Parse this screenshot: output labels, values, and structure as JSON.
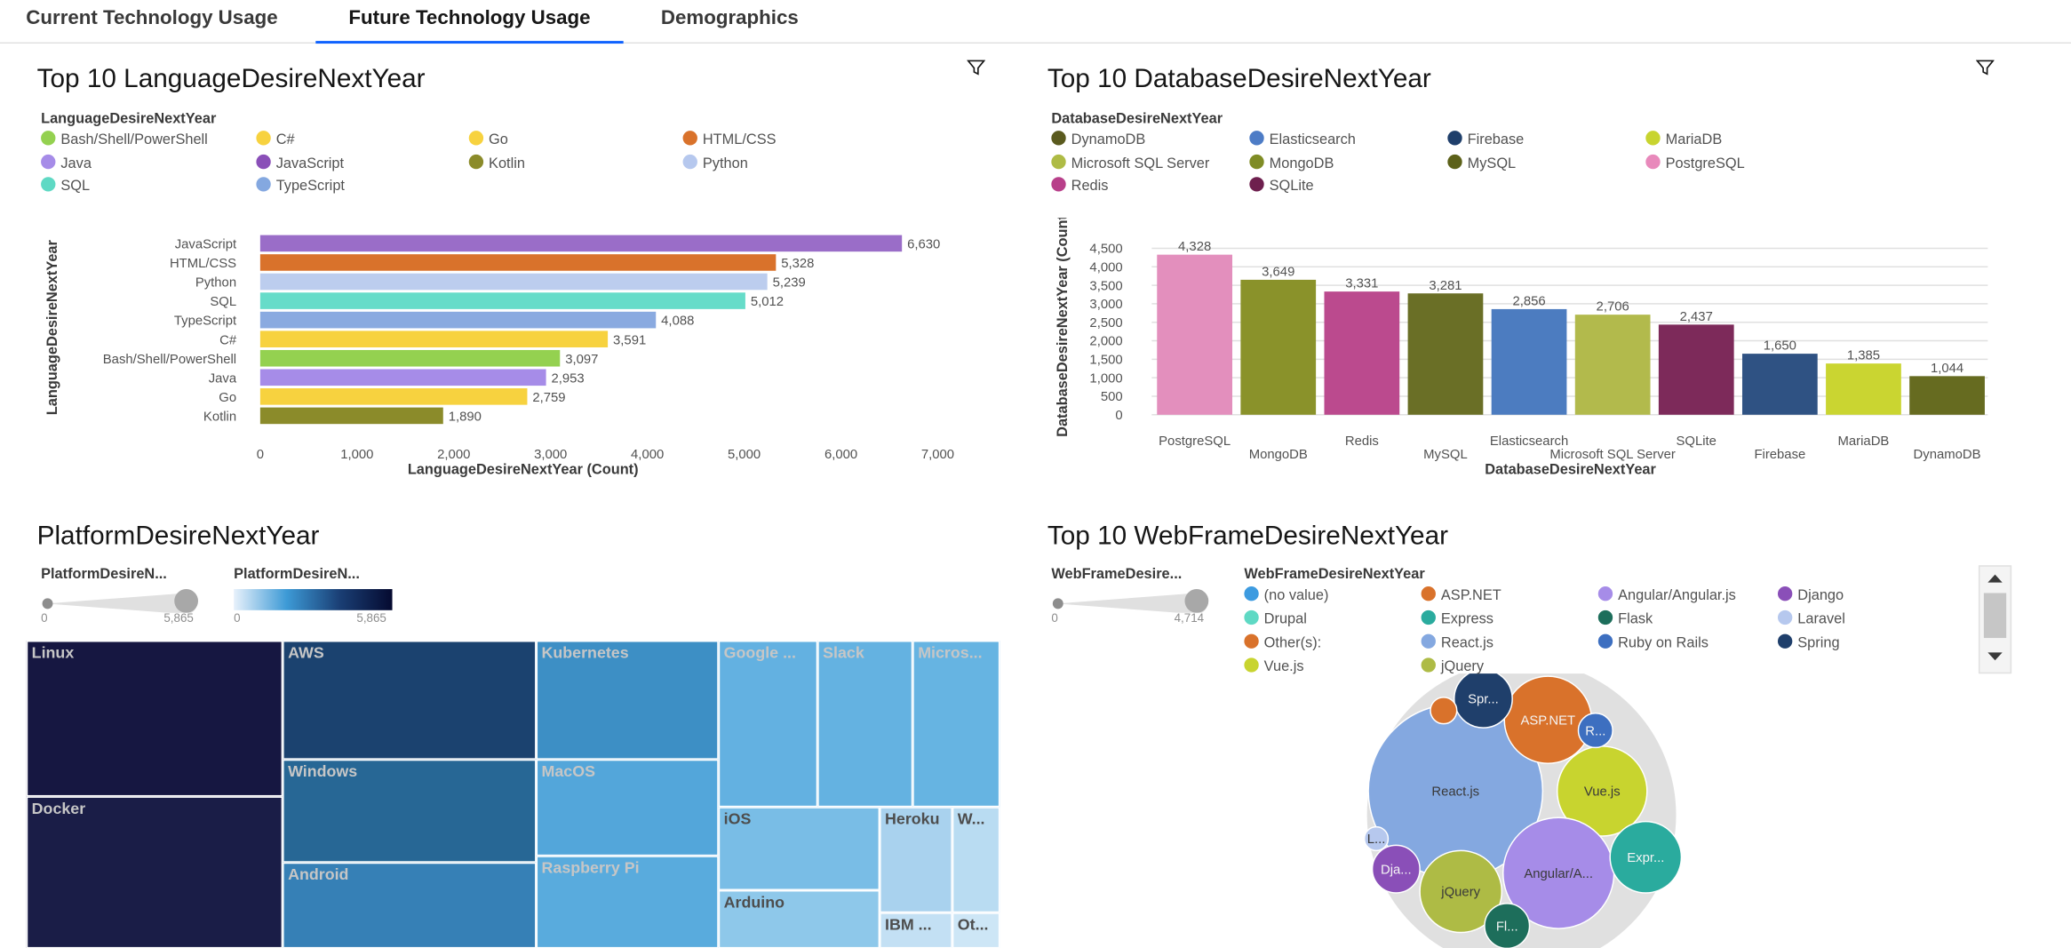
{
  "tabs": [
    {
      "label": "Current Technology Usage"
    },
    {
      "label": "Future Technology Usage"
    },
    {
      "label": "Demographics"
    }
  ],
  "language_panel": {
    "title": "Top 10 LanguageDesireNextYear",
    "legend_title": "LanguageDesireNextYear",
    "legend": [
      {
        "label": "Bash/Shell/PowerShell",
        "color": "#94d150"
      },
      {
        "label": "C#",
        "color": "#f7d23f"
      },
      {
        "label": "Go",
        "color": "#f7d23f"
      },
      {
        "label": "HTML/CSS",
        "color": "#d9722b"
      },
      {
        "label": "Java",
        "color": "#a68ce8"
      },
      {
        "label": "JavaScript",
        "color": "#8a4fb8"
      },
      {
        "label": "Kotlin",
        "color": "#8b8b2a"
      },
      {
        "label": "Python",
        "color": "#b6c8ee"
      },
      {
        "label": "SQL",
        "color": "#5fd9c4"
      },
      {
        "label": "TypeScript",
        "color": "#84a8e0"
      }
    ]
  },
  "database_panel": {
    "title": "Top 10 DatabaseDesireNextYear",
    "legend_title": "DatabaseDesireNextYear",
    "legend": [
      {
        "label": "DynamoDB",
        "color": "#5a5a1e"
      },
      {
        "label": "Elasticsearch",
        "color": "#4d7cc6"
      },
      {
        "label": "Firebase",
        "color": "#1f3f6b"
      },
      {
        "label": "MariaDB",
        "color": "#c8d42f"
      },
      {
        "label": "Microsoft SQL Server",
        "color": "#aebb45"
      },
      {
        "label": "MongoDB",
        "color": "#7f8c25"
      },
      {
        "label": "MySQL",
        "color": "#5c6119"
      },
      {
        "label": "PostgreSQL",
        "color": "#e889bb"
      },
      {
        "label": "Redis",
        "color": "#b83f8a"
      },
      {
        "label": "SQLite",
        "color": "#6e1f4e"
      }
    ]
  },
  "platform_panel": {
    "title": "PlatformDesireNextYear",
    "size_legend": {
      "title": "PlatformDesireN...",
      "min": "0",
      "max": "5,865"
    },
    "color_legend": {
      "title": "PlatformDesireN...",
      "min": "0",
      "max": "5,865"
    },
    "cells": [
      {
        "label": "Linux",
        "color": "#161741"
      },
      {
        "label": "Docker",
        "color": "#1a1d47"
      },
      {
        "label": "AWS",
        "color": "#1b426f"
      },
      {
        "label": "Windows",
        "color": "#276795"
      },
      {
        "label": "Android",
        "color": "#3680b6"
      },
      {
        "label": "Kubernetes",
        "color": "#3d8fc5"
      },
      {
        "label": "MacOS",
        "color": "#53a6da"
      },
      {
        "label": "Raspberry Pi",
        "color": "#59abdd"
      },
      {
        "label": "Google ...",
        "color": "#63b1e1"
      },
      {
        "label": "Slack",
        "color": "#64b2e1"
      },
      {
        "label": "Micros...",
        "color": "#66b4e2"
      },
      {
        "label": "iOS",
        "color": "#79bde6"
      },
      {
        "label": "Arduino",
        "color": "#8ec8ea"
      },
      {
        "label": "Heroku",
        "color": "#a9d2ee"
      },
      {
        "label": "W...",
        "color": "#b9dcf2"
      },
      {
        "label": "IBM ...",
        "color": "#c3e0f4"
      },
      {
        "label": "Ot...",
        "color": "#cde6f6"
      }
    ]
  },
  "webframe_panel": {
    "title": "Top 10 WebFrameDesireNextYear",
    "size_legend": {
      "title": "WebFrameDesire...",
      "min": "0",
      "max": "4,714"
    },
    "legend_title": "WebFrameDesireNextYear",
    "legend": [
      {
        "label": "(no value)",
        "color": "#3d9be0"
      },
      {
        "label": "ASP.NET",
        "color": "#d9722b"
      },
      {
        "label": "Angular/Angular.js",
        "color": "#a68ce8"
      },
      {
        "label": "Django",
        "color": "#8a4fb8"
      },
      {
        "label": "Drupal",
        "color": "#5fd9c4"
      },
      {
        "label": "Express",
        "color": "#2aab9e"
      },
      {
        "label": "Flask",
        "color": "#1d6e5b"
      },
      {
        "label": "Laravel",
        "color": "#b6c8ee"
      },
      {
        "label": "Other(s):",
        "color": "#d9722b"
      },
      {
        "label": "React.js",
        "color": "#84a8e0"
      },
      {
        "label": "Ruby on Rails",
        "color": "#3d6fc0"
      },
      {
        "label": "Spring",
        "color": "#1f3f6b"
      },
      {
        "label": "Vue.js",
        "color": "#c8d42f"
      },
      {
        "label": "jQuery",
        "color": "#aebb45"
      }
    ],
    "bubbles": [
      {
        "label": "React.js",
        "color": "#84a8e0"
      },
      {
        "label": "Vue.js",
        "color": "#c8d42f"
      },
      {
        "label": "Angular/A...",
        "color": "#a68ce8"
      },
      {
        "label": "ASP.NET",
        "color": "#d9722b"
      },
      {
        "label": "jQuery",
        "color": "#aebb45"
      },
      {
        "label": "Expr...",
        "color": "#2aab9e"
      },
      {
        "label": "Spr...",
        "color": "#1f3f6b"
      },
      {
        "label": "Dja...",
        "color": "#8a4fb8"
      },
      {
        "label": "R...",
        "color": "#3d6fc0"
      },
      {
        "label": "Fl...",
        "color": "#1d6e5b"
      },
      {
        "label": "L...",
        "color": "#b6c8ee"
      },
      {
        "label": "",
        "color": "#d9722b"
      }
    ]
  },
  "chart_data": [
    {
      "type": "bar",
      "orientation": "horizontal",
      "title": "Top 10 LanguageDesireNextYear",
      "xlabel": "LanguageDesireNextYear (Count)",
      "ylabel": "LanguageDesireNextYear",
      "categories": [
        "JavaScript",
        "HTML/CSS",
        "Python",
        "SQL",
        "TypeScript",
        "C#",
        "Bash/Shell/PowerShell",
        "Java",
        "Go",
        "Kotlin"
      ],
      "values": [
        6630,
        5328,
        5239,
        5012,
        4088,
        3591,
        3097,
        2953,
        2759,
        1890
      ],
      "value_labels": [
        "6,630",
        "5,328",
        "5,239",
        "5,012",
        "4,088",
        "3,591",
        "3,097",
        "2,953",
        "2,759",
        "1,890"
      ],
      "colors": [
        "#9a6dc8",
        "#d9722b",
        "#bccdee",
        "#66dcc9",
        "#8aaae0",
        "#f7d23f",
        "#94d150",
        "#a68ce8",
        "#f7d23f",
        "#8b8b2a"
      ],
      "ticks": [
        "0",
        "1,000",
        "2,000",
        "3,000",
        "4,000",
        "5,000",
        "6,000",
        "7,000"
      ],
      "xlim": [
        0,
        7000
      ],
      "legend": "top",
      "grid": false
    },
    {
      "type": "bar",
      "orientation": "vertical",
      "title": "Top 10 DatabaseDesireNextYear",
      "xlabel": "DatabaseDesireNextYear",
      "ylabel": "DatabaseDesireNextYear (Count)",
      "categories": [
        "PostgreSQL",
        "MongoDB",
        "Redis",
        "MySQL",
        "Elasticsearch",
        "Microsoft SQL Server",
        "SQLite",
        "Firebase",
        "MariaDB",
        "DynamoDB"
      ],
      "values": [
        4328,
        3649,
        3331,
        3281,
        2856,
        2706,
        2437,
        1650,
        1385,
        1044
      ],
      "value_labels": [
        "4,328",
        "3,649",
        "3,331",
        "3,281",
        "2,856",
        "2,706",
        "2,437",
        "1,650",
        "1,385",
        "1,044"
      ],
      "colors": [
        "#e38fbd",
        "#8a922a",
        "#bb4a8e",
        "#6a6f26",
        "#4c7cc0",
        "#b2ba4c",
        "#7d2a5a",
        "#2f5283",
        "#cad531",
        "#666b20"
      ],
      "ticks": [
        "0",
        "500",
        "1,000",
        "1,500",
        "2,000",
        "2,500",
        "3,000",
        "3,500",
        "4,000",
        "4,500"
      ],
      "ylim": [
        0,
        4500
      ],
      "legend": "top",
      "grid": true
    }
  ]
}
